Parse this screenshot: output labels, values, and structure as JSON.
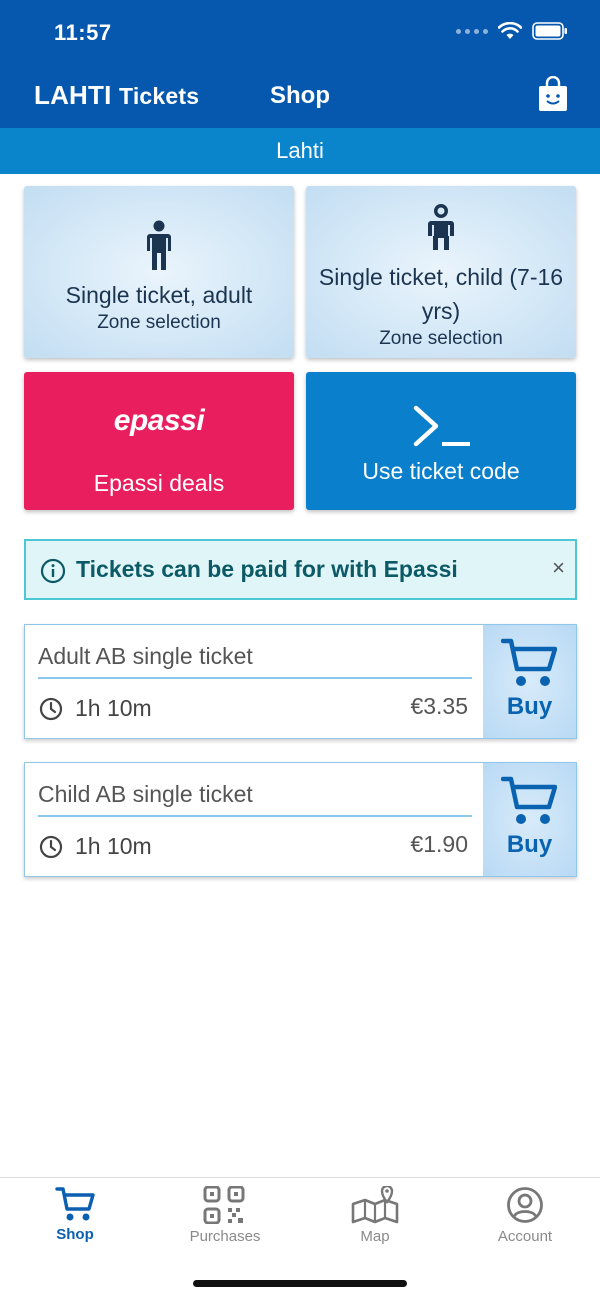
{
  "status": {
    "time": "11:57"
  },
  "header": {
    "brand_main": "LAHTI",
    "brand_sub": "Tickets",
    "title": "Shop",
    "bag_icon": "shopping-bag-icon"
  },
  "subbar": {
    "label": "Lahti"
  },
  "tiles": [
    {
      "title": "Single ticket, adult",
      "subtitle": "Zone selection",
      "icon": "adult-person-icon"
    },
    {
      "title": "Single ticket, child (7-16 yrs)",
      "subtitle": "Zone selection",
      "icon": "child-person-icon"
    },
    {
      "logo": "epassi",
      "title": "Epassi deals",
      "color": "#e81e5e"
    },
    {
      "title": "Use ticket code",
      "icon": "terminal-prompt-icon",
      "color": "#0a7fcc"
    }
  ],
  "info_banner": {
    "text": "Tickets can be paid for with Epassi",
    "close": "×",
    "icon": "info-icon"
  },
  "products": [
    {
      "name": "Adult AB single ticket",
      "duration": "1h 10m",
      "price": "€3.35",
      "buy_label": "Buy"
    },
    {
      "name": "Child AB single ticket",
      "duration": "1h 10m",
      "price": "€1.90",
      "buy_label": "Buy"
    }
  ],
  "tabs": [
    {
      "label": "Shop",
      "icon": "cart-icon",
      "active": true
    },
    {
      "label": "Purchases",
      "icon": "qr-code-icon",
      "active": false
    },
    {
      "label": "Map",
      "icon": "map-icon",
      "active": false
    },
    {
      "label": "Account",
      "icon": "account-icon",
      "active": false
    }
  ],
  "colors": {
    "header": "#0558ad",
    "subbar": "#0a85cc",
    "accent": "#0a5fb0",
    "info_border": "#4cc7d3"
  }
}
